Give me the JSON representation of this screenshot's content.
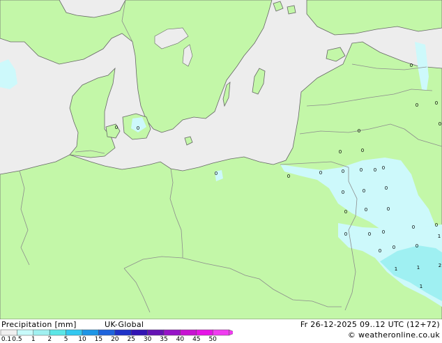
{
  "footer": {
    "title": "Precipitation [mm]",
    "model": "UK-Global",
    "datetime": "Fr 26-12-2025 09..12 UTC (12+72)",
    "credit": "© weatheronline.co.uk"
  },
  "legend": {
    "ticks": [
      "0.1",
      "0.5",
      "1",
      "2",
      "5",
      "10",
      "15",
      "20",
      "25",
      "30",
      "35",
      "40",
      "45",
      "50"
    ],
    "colors": [
      "#f0f0f0",
      "#c8fafa",
      "#a0f0f0",
      "#5ce6e6",
      "#32c8f0",
      "#1e96e6",
      "#1e64dc",
      "#1e32c8",
      "#3214b4",
      "#6414b4",
      "#9614c8",
      "#c814d2",
      "#e614e6",
      "#f03cf0"
    ]
  },
  "map": {
    "colors": {
      "land": "#c3f7a8",
      "sea": "#ededed",
      "border": "#8c8c8c",
      "coast": "#666666",
      "light_precip": "#cdf9fb",
      "medium_precip": "#9ff0f2"
    },
    "markers": [
      "0",
      "0",
      "0",
      "0",
      "0",
      "0",
      "0",
      "0",
      "0",
      "0",
      "0",
      "0",
      "0",
      "0",
      "0",
      "0",
      "0",
      "0",
      "0",
      "0",
      "0",
      "0",
      "0",
      "0",
      "0",
      "0",
      "0",
      "0",
      "0",
      "0",
      "1",
      "1",
      "1",
      "1",
      "2"
    ]
  }
}
